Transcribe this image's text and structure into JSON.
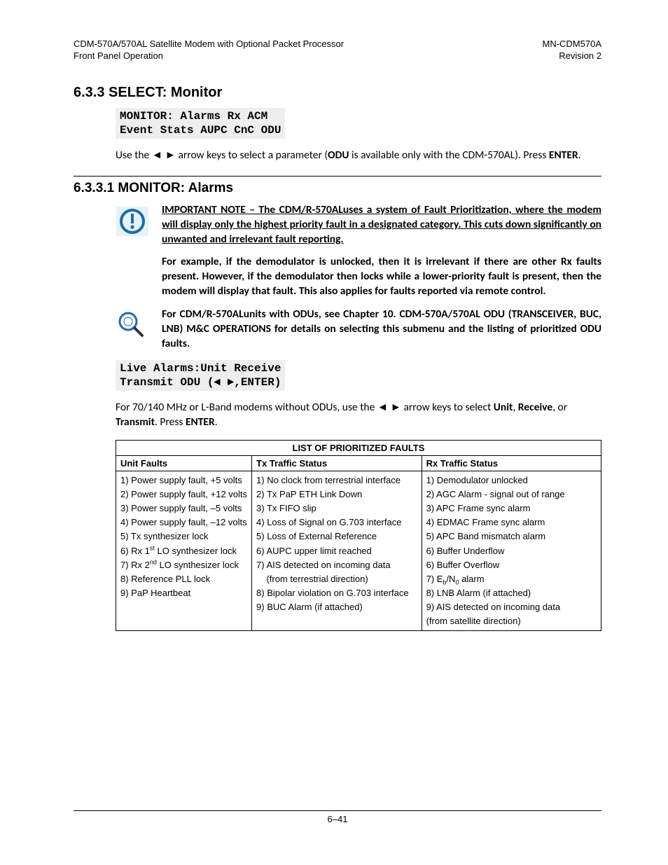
{
  "header": {
    "left_line1": "CDM-570A/570AL Satellite Modem with Optional Packet Processor",
    "left_line2": "Front Panel Operation",
    "right_line1": "MN-CDM570A",
    "right_line2": "Revision 2"
  },
  "section633": {
    "heading": "6.3.3  SELECT: Monitor",
    "code": "MONITOR: Alarms Rx ACM\nEvent Stats AUPC CnC ODU",
    "para_pre": "Use the ◄ ► arrow keys to select a parameter (",
    "para_bold": "ODU",
    "para_mid": " is available only with the CDM-570AL). Press ",
    "para_bold2": "ENTER",
    "para_post": "."
  },
  "section6331": {
    "heading": "6.3.3.1   MONITOR: Alarms",
    "note1": "IMPORTANT NOTE – The CDM/R-570ALuses a system of Fault Prioritization, where the modem will display only the highest priority fault in a designated category. This cuts down significantly on unwanted and irrelevant fault reporting.",
    "note1b": "For example, if the demodulator is unlocked, then it is irrelevant if there are other Rx faults present. However, if the demodulator then locks while a lower-priority fault is present, then the modem will display that fault. This also applies for faults reported via remote control.",
    "note2": "For CDM/R-570ALunits with ODUs, see Chapter 10. CDM-570A/570AL ODU (TRANSCEIVER, BUC, LNB) M&C OPERATIONS for details on selecting this submenu and the listing of prioritized ODU faults.",
    "code": "Live Alarms:Unit Receive\nTransmit ODU (◄ ►,ENTER)",
    "para2_pre": "For 70/140 MHz or L-Band modems without ODUs, use the ◄ ► arrow keys to select ",
    "para2_b1": "Unit",
    "para2_mid1": ", ",
    "para2_b2": "Receive",
    "para2_mid2": ", or ",
    "para2_b3": "Transmit",
    "para2_mid3": ". Press ",
    "para2_b4": "ENTER",
    "para2_post": "."
  },
  "table": {
    "title": "LIST OF PRIORITIZED FAULTS",
    "col1_hdr": "Unit Faults",
    "col2_hdr": "Tx Traffic Status",
    "col3_hdr": "Rx Traffic Status",
    "col1": [
      "1) Power supply fault,  +5 volts",
      "2) Power supply fault, +12 volts",
      "3) Power supply fault, –5 volts",
      "4) Power supply fault, –12 volts",
      "5) Tx synthesizer lock",
      "6) Rx 1ˢᵗ LO synthesizer lock",
      "7) Rx 2ⁿᵈ LO synthesizer lock",
      "8) Reference PLL lock",
      "9) PaP Heartbeat"
    ],
    "col2": [
      "1) No clock from terrestrial interface",
      "2) Tx PaP ETH Link Down",
      "3) Tx FIFO slip",
      "4) Loss of Signal on G.703 interface",
      "5) Loss of External Reference",
      "6) AUPC upper limit reached",
      "7) AIS detected on incoming data (from terrestrial direction)",
      "8) Bipolar violation on G.703 interface",
      "9) BUC Alarm (if attached)"
    ],
    "col3": [
      "1) Demodulator unlocked",
      "2) AGC Alarm - signal out of range",
      "3) APC Frame sync alarm",
      "4) EDMAC Frame sync alarm",
      "5) APC Band mismatch alarm",
      "6) Buffer Underflow",
      "6) Buffer Overflow",
      "7) Eb/N0 alarm",
      "8) LNB Alarm (if attached)",
      "9) AIS detected on incoming data (from satellite direction)"
    ]
  },
  "footer": "6–41"
}
